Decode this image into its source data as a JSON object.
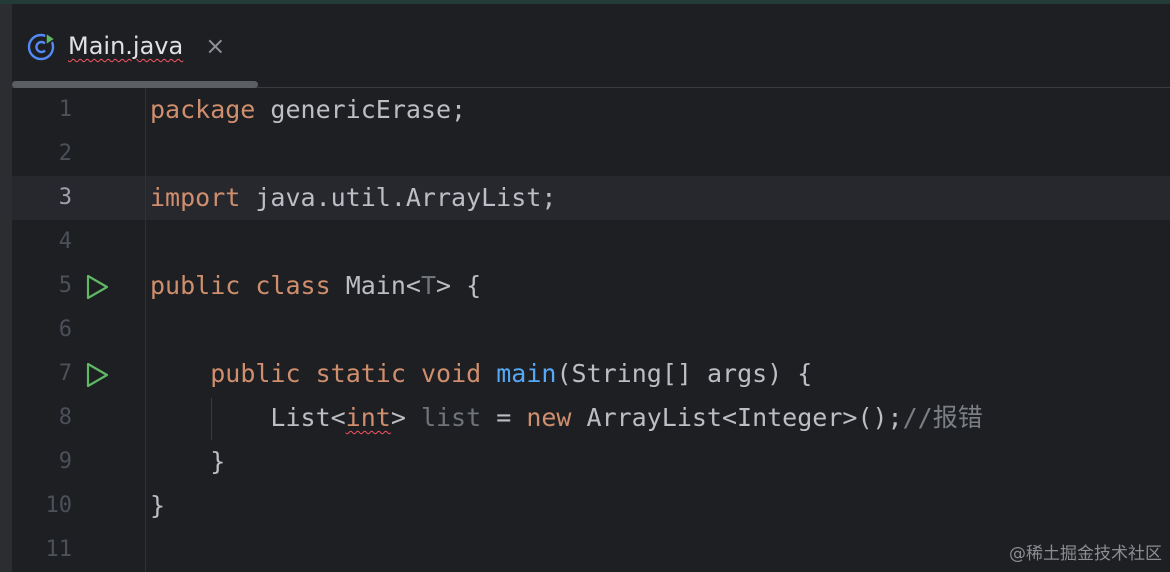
{
  "tab": {
    "filename": "Main.java",
    "file_icon": "java-class-icon",
    "close_glyph": "×"
  },
  "lines": [
    {
      "number": "1",
      "tokens": [
        {
          "t": "package",
          "c": "kw"
        },
        {
          "t": " genericErase;"
        }
      ]
    },
    {
      "number": "2",
      "tokens": []
    },
    {
      "number": "3",
      "current": true,
      "tokens": [
        {
          "t": "import",
          "c": "kw"
        },
        {
          "t": " java.util.ArrayList;"
        }
      ]
    },
    {
      "number": "4",
      "tokens": []
    },
    {
      "number": "5",
      "run": true,
      "tokens": [
        {
          "t": "public",
          "c": "kw"
        },
        {
          "t": " "
        },
        {
          "t": "class",
          "c": "kw"
        },
        {
          "t": " Main<"
        },
        {
          "t": "T",
          "c": "tp"
        },
        {
          "t": "> {"
        }
      ]
    },
    {
      "number": "6",
      "tokens": []
    },
    {
      "number": "7",
      "run": true,
      "tokens": [
        {
          "t": "    "
        },
        {
          "t": "public",
          "c": "kw"
        },
        {
          "t": " "
        },
        {
          "t": "static",
          "c": "kw"
        },
        {
          "t": " "
        },
        {
          "t": "void",
          "c": "kw"
        },
        {
          "t": " "
        },
        {
          "t": "main",
          "c": "fn"
        },
        {
          "t": "(String[] args) {"
        }
      ]
    },
    {
      "number": "8",
      "tokens": [
        {
          "t": "        List<"
        },
        {
          "t": "int",
          "c": "kw err"
        },
        {
          "t": "> "
        },
        {
          "t": "list",
          "c": "unused"
        },
        {
          "t": " = "
        },
        {
          "t": "new",
          "c": "kw"
        },
        {
          "t": " ArrayList<Integer>();"
        },
        {
          "t": "//报错",
          "c": "cm"
        }
      ]
    },
    {
      "number": "9",
      "tokens": [
        {
          "t": "    }"
        }
      ]
    },
    {
      "number": "10",
      "tokens": [
        {
          "t": "}"
        }
      ]
    },
    {
      "number": "11",
      "tokens": []
    }
  ],
  "watermark": "@稀土掘金技术社区",
  "colors": {
    "background": "#1e1f22",
    "keyword": "#cf8e6d",
    "function": "#56a8f5",
    "text": "#bcbec4",
    "comment": "#7a7e85",
    "error_underline": "#f75464",
    "run_gutter": "#5fb865"
  }
}
